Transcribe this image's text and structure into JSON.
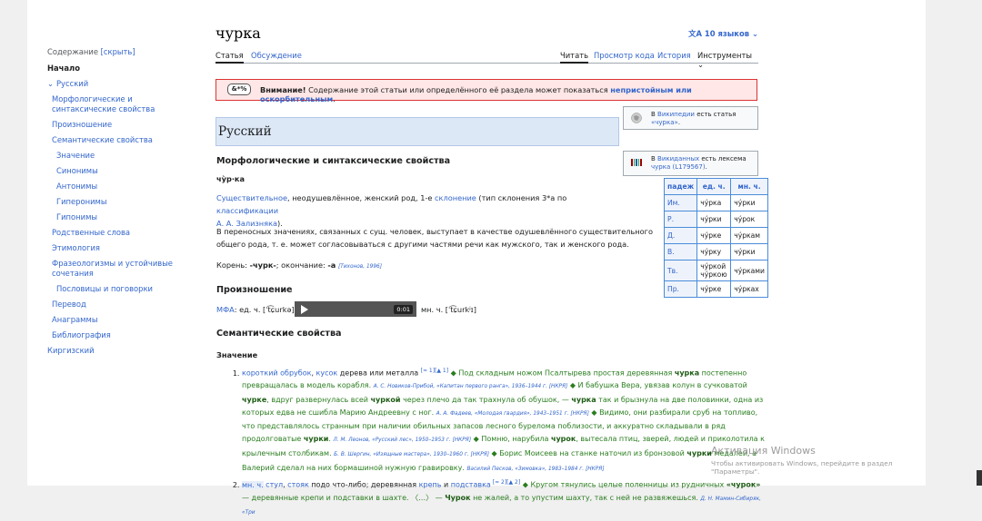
{
  "toc": {
    "header": "Содержание",
    "hide": "[скрыть]",
    "start": "Начало",
    "items": [
      {
        "label": "Русский",
        "level": 1
      },
      {
        "label": "Морфологические и синтаксические свойства",
        "level": 2
      },
      {
        "label": "Произношение",
        "level": 2
      },
      {
        "label": "Семантические свойства",
        "level": 2
      },
      {
        "label": "Значение",
        "level": 3
      },
      {
        "label": "Синонимы",
        "level": 3
      },
      {
        "label": "Антонимы",
        "level": 3
      },
      {
        "label": "Гиперонимы",
        "level": 3
      },
      {
        "label": "Гипонимы",
        "level": 3
      },
      {
        "label": "Родственные слова",
        "level": 2
      },
      {
        "label": "Этимология",
        "level": 2
      },
      {
        "label": "Фразеологизмы и устойчивые сочетания",
        "level": 2
      },
      {
        "label": "Пословицы и поговорки",
        "level": 3
      },
      {
        "label": "Перевод",
        "level": 2
      },
      {
        "label": "Анаграммы",
        "level": 2
      },
      {
        "label": "Библиография",
        "level": 2
      },
      {
        "label": "Киргизский",
        "level": 1
      }
    ]
  },
  "title": "чурка",
  "languages": "10 языков",
  "tabs": {
    "article": "Статья",
    "talk": "Обсуждение",
    "read": "Читать",
    "view_source": "Просмотр кода",
    "history": "История",
    "tools": "Инструменты"
  },
  "warning": {
    "icon_text": "&*%",
    "bold": "Внимание!",
    "text": " Содержание этой статьи или определённого её раздела может показаться ",
    "link": "непристойным или оскорбительным",
    "end": "."
  },
  "section_russian": "Русский",
  "morph": {
    "heading": "Морфологические и синтаксические свойства",
    "syllables": "чу̀р·ка",
    "p1_link1": "Существительное",
    "p1_text1": ", неодушевлённое, женский род, 1-е ",
    "p1_link2": "склонение",
    "p1_text2": " (тип склонения 3*a по ",
    "p1_link3": "классификации",
    "p1_link4": "А. А. Зализняка",
    "p1_text3": ").",
    "p2": "В переносных значениях, связанных с сущ. человек, выступает в качестве одушевлённого существительного общего рода, т. е. может согласовываться с другими частями речи как мужского, так и женского рода.",
    "root_label": "Корень: ",
    "root": "-чурк-",
    "ending_label": "; окончание: ",
    "ending": "-а",
    "source": "[Тихонов, 1996]"
  },
  "pron": {
    "heading": "Произношение",
    "ipa": "МФА",
    "sg": ": ед. ч. [ˈt͡ɕurkə]",
    "pl": "мн. ч. [ˈt͡ɕurkʲɪ]",
    "audio_time": "0:01"
  },
  "sem": {
    "heading": "Семантические свойства",
    "sub": "Значение"
  },
  "wiki_box": {
    "pre": "В ",
    "link": "Википедии",
    "mid": " есть статья ",
    "article": "«чурка»",
    "end": "."
  },
  "wikidata_box": {
    "pre": "В ",
    "link": "Викиданных",
    "mid": " есть лексема ",
    "lexeme": "чурка (L179567)",
    "end": "."
  },
  "declension": {
    "headers": [
      "падеж",
      "ед. ч.",
      "мн. ч."
    ],
    "rows": [
      [
        "Им.",
        "чу́рка",
        "чу́рки"
      ],
      [
        "Р.",
        "чу́рки",
        "чу́рок"
      ],
      [
        "Д.",
        "чу́рке",
        "чу́ркам"
      ],
      [
        "В.",
        "чу́рку",
        "чу́рки"
      ],
      [
        "Тв.",
        "чу́ркой чу́ркою",
        "чу́рками"
      ],
      [
        "Пр.",
        "чу́рке",
        "чу́рках"
      ]
    ]
  },
  "meanings": [
    {
      "html_parts": [
        {
          "t": "короткий обрубок",
          "c": "lnk"
        },
        {
          "t": ", ",
          "c": ""
        },
        {
          "t": "кусок",
          "c": "lnk"
        },
        {
          "t": " дерева или металла ",
          "c": ""
        },
        {
          "t": "[≈ 1][▲ 1]",
          "c": "sup"
        },
        {
          "t": " ◆ Под складным ножом Псалтырева простая деревянная ",
          "c": "green"
        },
        {
          "t": "чурка",
          "c": "greenb"
        },
        {
          "t": " постепенно превращалась в модель корабля. ",
          "c": "green"
        },
        {
          "t": "А. С. Новиков-Прибой, «Капитан первого ранга», 1936–1944 г. [НКРЯ]",
          "c": "src"
        },
        {
          "t": " ◆ И бабушка Вера, увязав колун в сучковатой ",
          "c": "green"
        },
        {
          "t": "чурке",
          "c": "greenb"
        },
        {
          "t": ", вдруг развернулась всей ",
          "c": "green"
        },
        {
          "t": "чуркой",
          "c": "greenb"
        },
        {
          "t": " через плечо да так трахнула об обушок, — ",
          "c": "green"
        },
        {
          "t": "чурка",
          "c": "greenb"
        },
        {
          "t": " так и брызнула на две половинки, одна из которых едва не сшибла Марию Андреевну с ног. ",
          "c": "green"
        },
        {
          "t": "А. А. Фадеев, «Молодая гвардия», 1943–1951 г. [НКРЯ]",
          "c": "src"
        },
        {
          "t": " ◆ Видимо, они разбирали сруб на топливо, что представлялось странным при наличии обильных запасов лесного бурелома поблизости, и аккуратно складывали в ряд продолговатые ",
          "c": "green"
        },
        {
          "t": "чурки",
          "c": "greenb"
        },
        {
          "t": ". ",
          "c": "green"
        },
        {
          "t": "Л. М. Леонов, «Русский лес», 1950–1953 г. [НКРЯ]",
          "c": "src"
        },
        {
          "t": " ◆ Помню, нарубила ",
          "c": "green"
        },
        {
          "t": "чурок",
          "c": "greenb"
        },
        {
          "t": ", вытесала птиц, зверей, людей и приколотила к крылечным столбикам. ",
          "c": "green"
        },
        {
          "t": "Б. В. Шергин, «Изящные мастера», 1930–1960 г. [НКРЯ]",
          "c": "src"
        },
        {
          "t": " ◆ Борис Моисеев на станке наточил из бронзовой ",
          "c": "green"
        },
        {
          "t": "чурки",
          "c": "greenb"
        },
        {
          "t": " медалей, а Валерий сделал на них бормашиной нужную гравировку. ",
          "c": "green"
        },
        {
          "t": "Василий Песков, «Зимовка», 1983–1984 г. [НКРЯ]",
          "c": "src"
        }
      ]
    },
    {
      "html_parts": [
        {
          "t": "мн. ч.",
          "c": "lnkbg"
        },
        {
          "t": " ",
          "c": ""
        },
        {
          "t": "стул",
          "c": "lnk"
        },
        {
          "t": ", ",
          "c": ""
        },
        {
          "t": "стояк",
          "c": "lnk"
        },
        {
          "t": " подо что-либо; деревянная ",
          "c": ""
        },
        {
          "t": "крепь",
          "c": "lnk"
        },
        {
          "t": " и ",
          "c": ""
        },
        {
          "t": "подставка",
          "c": "lnk"
        },
        {
          "t": " [≈ 2][▲ 2]",
          "c": "sup"
        },
        {
          "t": " ◆ Кругом тянулись целые поленницы из рудничных ",
          "c": "green"
        },
        {
          "t": "«чурок»",
          "c": "greenb"
        },
        {
          "t": " — деревянные крепи и подставки в шахте. 〈…〉 — ",
          "c": "green"
        },
        {
          "t": "Чурок",
          "c": "greenb"
        },
        {
          "t": " не жалей, а то упустим шахту, так с ней не развяжешься. ",
          "c": "green"
        },
        {
          "t": "Д. Н. Мамин-Сибиряк, «Три",
          "c": "src"
        }
      ]
    }
  ],
  "activation": {
    "title": "Активация Windows",
    "text": "Чтобы активировать Windows, перейдите в раздел \"Параметры\"."
  }
}
